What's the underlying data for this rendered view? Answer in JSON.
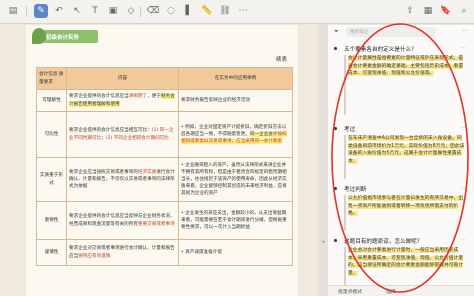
{
  "toolbar": {
    "icons": [
      "sidebar-icon",
      "pen-icon",
      "undo-icon",
      "redo-icon",
      "select-icon",
      "text-icon",
      "image-icon",
      "shape-icon",
      "eraser-icon",
      "lasso-icon",
      "highlighter-icon",
      "ruler-icon",
      "link-icon",
      "more-icon",
      "share-icon",
      "grid-icon",
      "bookmark-icon"
    ]
  },
  "document": {
    "section_title": "初级会计实务",
    "continued_label": "续表",
    "table": {
      "headers": [
        "会计信息\n质量要求",
        "内容",
        "在实务中的应用举例"
      ],
      "rows": [
        {
          "name": "可理解性",
          "content_parts": [
            {
              "t": "要求企业提供的会计信息应当"
            },
            {
              "t": "清晰明了",
              "c": "red"
            },
            {
              "t": "，便于"
            },
            {
              "t": "财务会计报告使用者理解和使用",
              "c": "hl"
            }
          ],
          "example": "要求财务报告反映企业的经济活动"
        },
        {
          "name": "可比性",
          "content_parts": [
            {
              "t": "要求企业提供的会计信息应当相互可比："
            },
            {
              "t": "(1) 同一企业不同时期可比",
              "c": "red"
            },
            {
              "t": "；"
            },
            {
              "t": "(2) 不同企业相同会计期间可比",
              "c": "red"
            }
          ],
          "example_parts": [
            {
              "t": "• 例如，企业对固定资产计提折旧，确定折旧方法以后各期应当一致，不得随意变更。"
            },
            {
              "t": "同一企业会计",
              "c": "hl"
            },
            {
              "t": "按照相同或者类似交易或事项，应当采用同一会计政策",
              "c": "hlred"
            }
          ]
        },
        {
          "name": "实质重于形式",
          "content_parts": [
            {
              "t": "要求企业应当按照交易或者事项的"
            },
            {
              "t": "经济实质",
              "c": "red"
            },
            {
              "t": "进行会计确认、计量和报告，不仅仅以交易或者事项的法律形式为依据"
            }
          ],
          "example": "• 企业融资租入的资产，虽然从法律形式来讲企业并不拥有其所有权，但是由于租赁合同规定的租赁期相当长，往往接近于该资产的使用寿命，因此从经济实质来看，企业能够控制其创造的未来经济利益，应将其视为企业的资产"
        },
        {
          "name": "重要性",
          "content_parts": [
            {
              "t": "要求企业提供的会计信息应当反映与企业财务状况、经营成果和现金流量等有关的所有"
            },
            {
              "t": "重要交易或者事项",
              "c": "red"
            }
          ],
          "example": "• 企业发生的某些支出，金额较小的，从支出受益期来看，可能需要在若干会计期间进行分摊，但根据重要性要求，可以一次计入当期损益"
        },
        {
          "name": "谨慎性",
          "content_parts": [
            {
              "t": "要求企业对交易或者事项进行会计确认、计量和报告应当"
            },
            {
              "t": "保持应有的谨慎",
              "c": "red"
            }
          ],
          "example": "• 资产减值准备计提"
        }
      ]
    }
  },
  "notes": {
    "search_placeholder": "搜索笔记",
    "items": [
      {
        "question": "五个要素各自的定义是什么？",
        "answer": "会计计量属性是指要素的计量特征或外在表现形式，是对会计要素金额的确定基础，主要包括历史成本、重置成本、可变现净值、现值和公允价值等。"
      },
      {
        "question": "考过",
        "answer": "在车床产清查中A公司发现一台全新的未入账设备，同类设备目前市场价为1万元，实际价值为8万元，因此该设备的入账价值为5万元，这属于会计计量属性重置成本。"
      },
      {
        "question": "考过判断",
        "answer": "公允价值指市场参与者在计量日发生的有序交易中，出售一项资产所能收到或者转移一项负债所需支付的价格。"
      },
      {
        "question": "这题目有的题原谅，怎么做呢？",
        "answer": "企业会对会计要素进行计量时，一般应当采用历史成本，采用重置成本、可变现净值、现值、公允价值计量的，应当保证所确定的会计要素金额能够取得并可靠计量。"
      }
    ]
  },
  "bottom_bar": {
    "left": "批量点模式",
    "right": "选择"
  }
}
